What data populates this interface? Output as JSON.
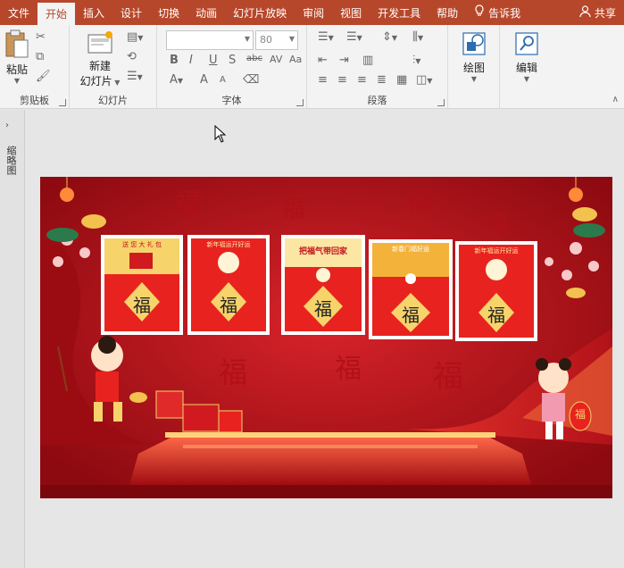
{
  "tabs": [
    {
      "label": "文件"
    },
    {
      "label": "开始",
      "active": true
    },
    {
      "label": "插入"
    },
    {
      "label": "设计"
    },
    {
      "label": "切换"
    },
    {
      "label": "动画"
    },
    {
      "label": "幻灯片放映"
    },
    {
      "label": "审阅"
    },
    {
      "label": "视图"
    },
    {
      "label": "开发工具"
    },
    {
      "label": "帮助"
    }
  ],
  "tell_me": "告诉我",
  "share": "共享",
  "ribbon": {
    "clipboard": {
      "label": "剪贴板",
      "paste": "粘贴"
    },
    "slides": {
      "label": "幻灯片",
      "new_slide_line1": "新建",
      "new_slide_line2": "幻灯片"
    },
    "font": {
      "label": "字体",
      "font_name": "",
      "font_size": "80"
    },
    "paragraph": {
      "label": "段落"
    },
    "drawing": {
      "label": "绘图"
    },
    "editing": {
      "label": "编辑"
    }
  },
  "left_panel_label": "缩略图",
  "slide": {
    "cards": [
      {
        "top_text": "送 您 大 礼 包",
        "char": "福"
      },
      {
        "top_text": "新年福运开好运",
        "char": "福"
      },
      {
        "top_text": "把福气带回家",
        "char": "福"
      },
      {
        "top_text": "新春门福好运",
        "char": "福"
      },
      {
        "top_text": "新年福运开好运",
        "char": "福"
      }
    ],
    "lantern_char": "福"
  },
  "colors": {
    "accent": "#b7472a",
    "slide_red": "#c3141c",
    "gold": "#f2c14e"
  }
}
